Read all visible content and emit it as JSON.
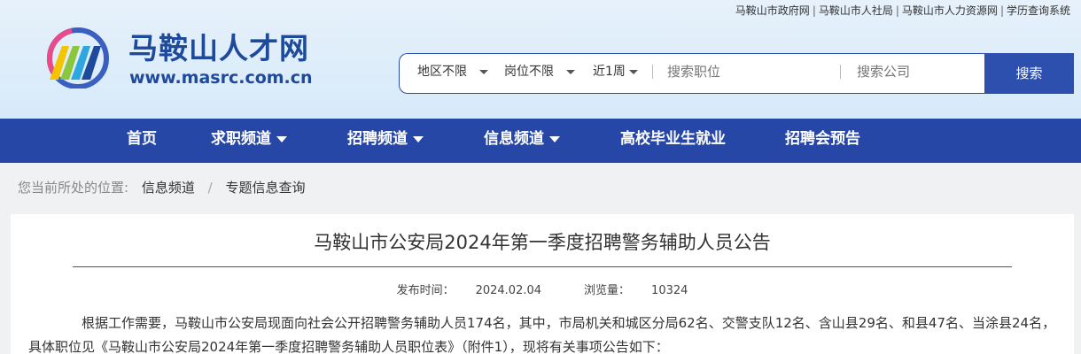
{
  "toplinks": [
    "马鞍山市政府网",
    "马鞍山市人社局",
    "马鞍山市人力资源网",
    "学历查询系统"
  ],
  "site": {
    "title": "马鞍山人才网",
    "url": "www.masrc.com.cn"
  },
  "search": {
    "filters": [
      "地区不限",
      "岗位不限",
      "近1周"
    ],
    "job_placeholder": "搜索职位",
    "company_placeholder": "搜索公司",
    "button": "搜索"
  },
  "nav": [
    {
      "label": "首页",
      "dropdown": false
    },
    {
      "label": "求职频道",
      "dropdown": true
    },
    {
      "label": "招聘频道",
      "dropdown": true
    },
    {
      "label": "信息频道",
      "dropdown": true
    },
    {
      "label": "高校毕业生就业",
      "dropdown": false
    },
    {
      "label": "招聘会预告",
      "dropdown": false
    }
  ],
  "breadcrumb": {
    "prefix": "您当前所处的位置:",
    "items": [
      "信息频道",
      "专题信息查询"
    ],
    "separator": "/"
  },
  "article": {
    "title": "马鞍山市公安局2024年第一季度招聘警务辅助人员公告",
    "publish_label": "发布时间：",
    "publish_date": "2024.02.04",
    "views_label": "浏览量：",
    "views": "10324",
    "paragraph": "根据工作需要，马鞍山市公安局现面向社会公开招聘警务辅助人员174名，其中，市局机关和城区分局62名、交警支队12名、含山县29名、和县47名、当涂县24名，具体职位见《马鞍山市公安局2024年第一季度招聘警务辅助人员职位表》（附件1），现将有关事项公告如下："
  },
  "colors": {
    "brand_blue": "#2647a6",
    "title_blue": "#1e4a9b"
  }
}
